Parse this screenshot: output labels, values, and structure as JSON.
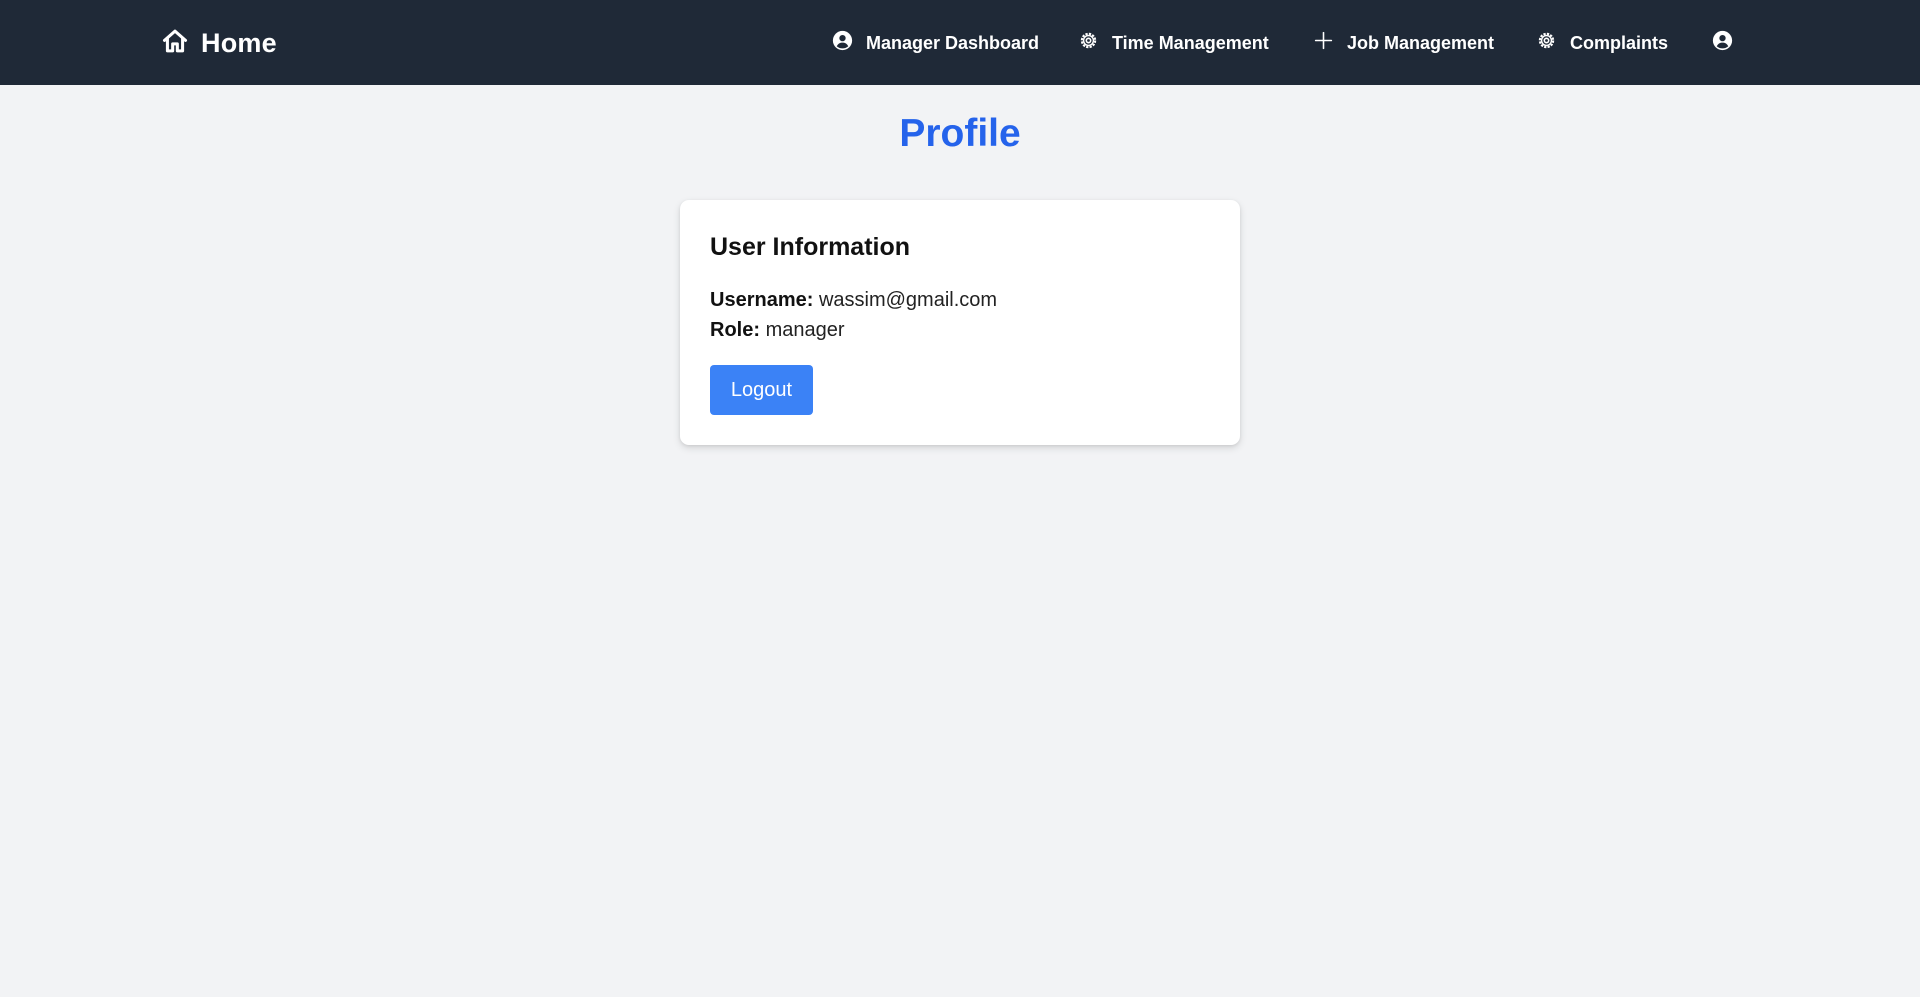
{
  "navbar": {
    "brand": {
      "label": "Home",
      "icon": "home-icon"
    },
    "items": [
      {
        "label": "Manager Dashboard",
        "icon": "user-circle-icon"
      },
      {
        "label": "Time Management",
        "icon": "gear-icon"
      },
      {
        "label": "Job Management",
        "icon": "plus-icon"
      },
      {
        "label": "Complaints",
        "icon": "gear-icon"
      }
    ],
    "profile_icon": "user-circle-icon",
    "background_color": "#1f2937"
  },
  "page": {
    "title": "Profile",
    "title_color": "#2563eb",
    "background_color": "#f2f3f5"
  },
  "card": {
    "title": "User Information",
    "username_label": "Username:",
    "username_value": "wassim@gmail.com",
    "role_label": "Role:",
    "role_value": "manager",
    "logout_label": "Logout",
    "button_color": "#3b82f6"
  }
}
